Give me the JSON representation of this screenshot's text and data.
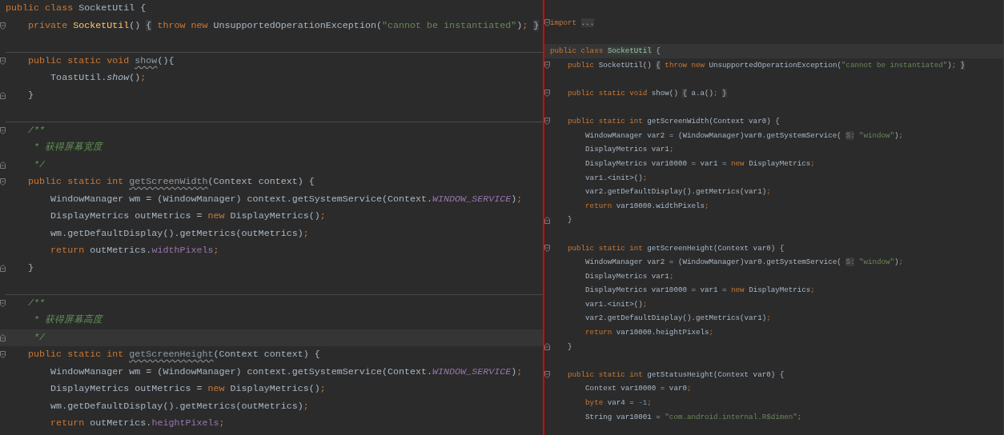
{
  "left_editor": {
    "lines": [
      {
        "kind": "code",
        "tokens": [
          {
            "kind": "kw",
            "text": "public class "
          },
          {
            "kind": "txt",
            "text": "SocketUtil {"
          }
        ]
      },
      {
        "kind": "fold_start",
        "tokens": [
          {
            "kind": "kw",
            "text": "    private "
          },
          {
            "kind": "decl",
            "text": "SocketUtil"
          },
          {
            "kind": "txt",
            "text": "() "
          },
          {
            "kind": "fold",
            "text": "{"
          },
          {
            "kind": "kw",
            "text": " throw new "
          },
          {
            "kind": "txt",
            "text": "UnsupportedOperationException("
          },
          {
            "kind": "str",
            "text": "\"cannot be instantiated\""
          },
          {
            "kind": "txt",
            "text": ")"
          },
          {
            "kind": "sem",
            "text": "; "
          },
          {
            "kind": "fold",
            "text": "}"
          }
        ]
      },
      {
        "kind": "blank"
      },
      {
        "kind": "divider"
      },
      {
        "kind": "fold_start",
        "tokens": [
          {
            "kind": "kw",
            "text": "    public static void "
          },
          {
            "kind": "warn",
            "text": "show"
          },
          {
            "kind": "txt",
            "text": "(){"
          }
        ]
      },
      {
        "kind": "code",
        "tokens": [
          {
            "kind": "txt",
            "text": "        ToastUtil."
          },
          {
            "kind": "ital",
            "text": "show"
          },
          {
            "kind": "txt",
            "text": "()"
          },
          {
            "kind": "sem",
            "text": ";"
          }
        ]
      },
      {
        "kind": "fold_end",
        "tokens": [
          {
            "kind": "txt",
            "text": "    }"
          }
        ]
      },
      {
        "kind": "blank"
      },
      {
        "kind": "divider"
      },
      {
        "kind": "fold_start",
        "tokens": [
          {
            "kind": "cmt",
            "text": "    /**"
          }
        ]
      },
      {
        "kind": "code",
        "tokens": [
          {
            "kind": "cmt",
            "text": "     * 获得屏幕宽度"
          }
        ]
      },
      {
        "kind": "fold_end",
        "tokens": [
          {
            "kind": "cmt",
            "text": "     */"
          }
        ]
      },
      {
        "kind": "fold_start",
        "tokens": [
          {
            "kind": "kw",
            "text": "    public static int "
          },
          {
            "kind": "warn",
            "text": "getScreenWidth"
          },
          {
            "kind": "txt",
            "text": "(Context context) {"
          }
        ]
      },
      {
        "kind": "code",
        "tokens": [
          {
            "kind": "txt",
            "text": "        WindowManager wm = (WindowManager) context.getSystemService(Context."
          },
          {
            "kind": "cst",
            "text": "WINDOW_SERVICE"
          },
          {
            "kind": "txt",
            "text": ")"
          },
          {
            "kind": "sem",
            "text": ";"
          }
        ]
      },
      {
        "kind": "code",
        "tokens": [
          {
            "kind": "txt",
            "text": "        DisplayMetrics outMetrics = "
          },
          {
            "kind": "kw",
            "text": "new "
          },
          {
            "kind": "txt",
            "text": "DisplayMetrics()"
          },
          {
            "kind": "sem",
            "text": ";"
          }
        ]
      },
      {
        "kind": "code",
        "tokens": [
          {
            "kind": "txt",
            "text": "        wm.getDefaultDisplay().getMetrics(outMetrics)"
          },
          {
            "kind": "sem",
            "text": ";"
          }
        ]
      },
      {
        "kind": "code",
        "tokens": [
          {
            "kind": "kw",
            "text": "        return "
          },
          {
            "kind": "txt",
            "text": "outMetrics."
          },
          {
            "kind": "fld",
            "text": "widthPixels"
          },
          {
            "kind": "sem",
            "text": ";"
          }
        ]
      },
      {
        "kind": "fold_end",
        "tokens": [
          {
            "kind": "txt",
            "text": "    }"
          }
        ]
      },
      {
        "kind": "blank"
      },
      {
        "kind": "divider"
      },
      {
        "kind": "fold_start",
        "tokens": [
          {
            "kind": "cmt",
            "text": "    /**"
          }
        ]
      },
      {
        "kind": "code",
        "tokens": [
          {
            "kind": "cmt",
            "text": "     * 获得屏幕高度"
          }
        ]
      },
      {
        "kind": "fold_end",
        "current": true,
        "tokens": [
          {
            "kind": "cmt",
            "text": "     */"
          }
        ]
      },
      {
        "kind": "fold_start",
        "tokens": [
          {
            "kind": "kw",
            "text": "    public static int "
          },
          {
            "kind": "warn",
            "text": "getScreenHeight"
          },
          {
            "kind": "txt",
            "text": "(Context context) {"
          }
        ]
      },
      {
        "kind": "code",
        "tokens": [
          {
            "kind": "txt",
            "text": "        WindowManager wm = (WindowManager) context.getSystemService(Context."
          },
          {
            "kind": "cst",
            "text": "WINDOW_SERVICE"
          },
          {
            "kind": "txt",
            "text": ")"
          },
          {
            "kind": "sem",
            "text": ";"
          }
        ]
      },
      {
        "kind": "code",
        "tokens": [
          {
            "kind": "txt",
            "text": "        DisplayMetrics outMetrics = "
          },
          {
            "kind": "kw",
            "text": "new "
          },
          {
            "kind": "txt",
            "text": "DisplayMetrics()"
          },
          {
            "kind": "sem",
            "text": ";"
          }
        ]
      },
      {
        "kind": "code",
        "tokens": [
          {
            "kind": "txt",
            "text": "        wm.getDefaultDisplay().getMetrics(outMetrics)"
          },
          {
            "kind": "sem",
            "text": ";"
          }
        ]
      },
      {
        "kind": "code",
        "tokens": [
          {
            "kind": "kw",
            "text": "        return "
          },
          {
            "kind": "txt",
            "text": "outMetrics."
          },
          {
            "kind": "fld",
            "text": "heightPixels"
          },
          {
            "kind": "sem",
            "text": ";"
          }
        ]
      }
    ]
  },
  "right_editor": {
    "lines": [
      {
        "kind": "fold_start",
        "tokens": [
          {
            "kind": "kw",
            "text": "import "
          },
          {
            "kind": "fold",
            "text": "..."
          }
        ]
      },
      {
        "kind": "blank"
      },
      {
        "kind": "code",
        "current": true,
        "tokens": [
          {
            "kind": "kw",
            "text": "public class "
          },
          {
            "kind": "ident",
            "text": "SocketUtil"
          },
          {
            "kind": "txt",
            "text": " {"
          }
        ]
      },
      {
        "kind": "fold_start",
        "tokens": [
          {
            "kind": "kw",
            "text": "    public "
          },
          {
            "kind": "txt",
            "text": "SocketUtil() "
          },
          {
            "kind": "fold",
            "text": "{"
          },
          {
            "kind": "kw",
            "text": " throw new "
          },
          {
            "kind": "txt",
            "text": "UnsupportedOperationException("
          },
          {
            "kind": "str",
            "text": "\"cannot be instantiated\""
          },
          {
            "kind": "txt",
            "text": ")"
          },
          {
            "kind": "sem",
            "text": "; "
          },
          {
            "kind": "fold",
            "text": "}"
          }
        ]
      },
      {
        "kind": "blank"
      },
      {
        "kind": "fold_start",
        "tokens": [
          {
            "kind": "kw",
            "text": "    public static void "
          },
          {
            "kind": "txt",
            "text": "show() "
          },
          {
            "kind": "fold",
            "text": "{"
          },
          {
            "kind": "txt",
            "text": " a.a()"
          },
          {
            "kind": "sem",
            "text": "; "
          },
          {
            "kind": "fold",
            "text": "}"
          }
        ]
      },
      {
        "kind": "blank"
      },
      {
        "kind": "fold_start",
        "tokens": [
          {
            "kind": "kw",
            "text": "    public static int "
          },
          {
            "kind": "txt",
            "text": "getScreenWidth(Context var0) {"
          }
        ]
      },
      {
        "kind": "code",
        "tokens": [
          {
            "kind": "txt",
            "text": "        WindowManager var2 = (WindowManager)var0.getSystemService( "
          },
          {
            "kind": "hint",
            "text": "S:"
          },
          {
            "kind": "str",
            "text": " \"window\""
          },
          {
            "kind": "txt",
            "text": ")"
          },
          {
            "kind": "sem",
            "text": ";"
          }
        ]
      },
      {
        "kind": "code",
        "tokens": [
          {
            "kind": "txt",
            "text": "        DisplayMetrics var1"
          },
          {
            "kind": "sem",
            "text": ";"
          }
        ]
      },
      {
        "kind": "code",
        "tokens": [
          {
            "kind": "txt",
            "text": "        DisplayMetrics var10000 = var1 = "
          },
          {
            "kind": "kw",
            "text": "new "
          },
          {
            "kind": "txt",
            "text": "DisplayMetrics"
          },
          {
            "kind": "sem",
            "text": ";"
          }
        ]
      },
      {
        "kind": "code",
        "tokens": [
          {
            "kind": "txt",
            "text": "        var1.<init>()"
          },
          {
            "kind": "sem",
            "text": ";"
          }
        ]
      },
      {
        "kind": "code",
        "tokens": [
          {
            "kind": "txt",
            "text": "        var2.getDefaultDisplay().getMetrics(var1)"
          },
          {
            "kind": "sem",
            "text": ";"
          }
        ]
      },
      {
        "kind": "code",
        "tokens": [
          {
            "kind": "kw",
            "text": "        return "
          },
          {
            "kind": "txt",
            "text": "var10000.widthPixels"
          },
          {
            "kind": "sem",
            "text": ";"
          }
        ]
      },
      {
        "kind": "fold_end",
        "tokens": [
          {
            "kind": "txt",
            "text": "    }"
          }
        ]
      },
      {
        "kind": "blank"
      },
      {
        "kind": "fold_start",
        "tokens": [
          {
            "kind": "kw",
            "text": "    public static int "
          },
          {
            "kind": "txt",
            "text": "getScreenHeight(Context var0) {"
          }
        ]
      },
      {
        "kind": "code",
        "tokens": [
          {
            "kind": "txt",
            "text": "        WindowManager var2 = (WindowManager)var0.getSystemService( "
          },
          {
            "kind": "hint",
            "text": "S:"
          },
          {
            "kind": "str",
            "text": " \"window\""
          },
          {
            "kind": "txt",
            "text": ")"
          },
          {
            "kind": "sem",
            "text": ";"
          }
        ]
      },
      {
        "kind": "code",
        "tokens": [
          {
            "kind": "txt",
            "text": "        DisplayMetrics var1"
          },
          {
            "kind": "sem",
            "text": ";"
          }
        ]
      },
      {
        "kind": "code",
        "tokens": [
          {
            "kind": "txt",
            "text": "        DisplayMetrics var10000 = var1 = "
          },
          {
            "kind": "kw",
            "text": "new "
          },
          {
            "kind": "txt",
            "text": "DisplayMetrics"
          },
          {
            "kind": "sem",
            "text": ";"
          }
        ]
      },
      {
        "kind": "code",
        "tokens": [
          {
            "kind": "txt",
            "text": "        var1.<init>()"
          },
          {
            "kind": "sem",
            "text": ";"
          }
        ]
      },
      {
        "kind": "code",
        "tokens": [
          {
            "kind": "txt",
            "text": "        var2.getDefaultDisplay().getMetrics(var1)"
          },
          {
            "kind": "sem",
            "text": ";"
          }
        ]
      },
      {
        "kind": "code",
        "tokens": [
          {
            "kind": "kw",
            "text": "        return "
          },
          {
            "kind": "txt",
            "text": "var10000.heightPixels"
          },
          {
            "kind": "sem",
            "text": ";"
          }
        ]
      },
      {
        "kind": "fold_end",
        "tokens": [
          {
            "kind": "txt",
            "text": "    }"
          }
        ]
      },
      {
        "kind": "blank"
      },
      {
        "kind": "fold_start",
        "tokens": [
          {
            "kind": "kw",
            "text": "    public static int "
          },
          {
            "kind": "txt",
            "text": "getStatusHeight(Context var0) {"
          }
        ]
      },
      {
        "kind": "code",
        "tokens": [
          {
            "kind": "txt",
            "text": "        Context var10000 = var0"
          },
          {
            "kind": "sem",
            "text": ";"
          }
        ]
      },
      {
        "kind": "code",
        "tokens": [
          {
            "kind": "kw",
            "text": "        byte "
          },
          {
            "kind": "txt",
            "text": "var4 = "
          },
          {
            "kind": "num",
            "text": "-1"
          },
          {
            "kind": "sem",
            "text": ";"
          }
        ]
      },
      {
        "kind": "code",
        "tokens": [
          {
            "kind": "txt",
            "text": "        String var10001 = "
          },
          {
            "kind": "str",
            "text": "\"com.android.internal.R$dimen\""
          },
          {
            "kind": "sem",
            "text": ";"
          }
        ]
      }
    ]
  }
}
